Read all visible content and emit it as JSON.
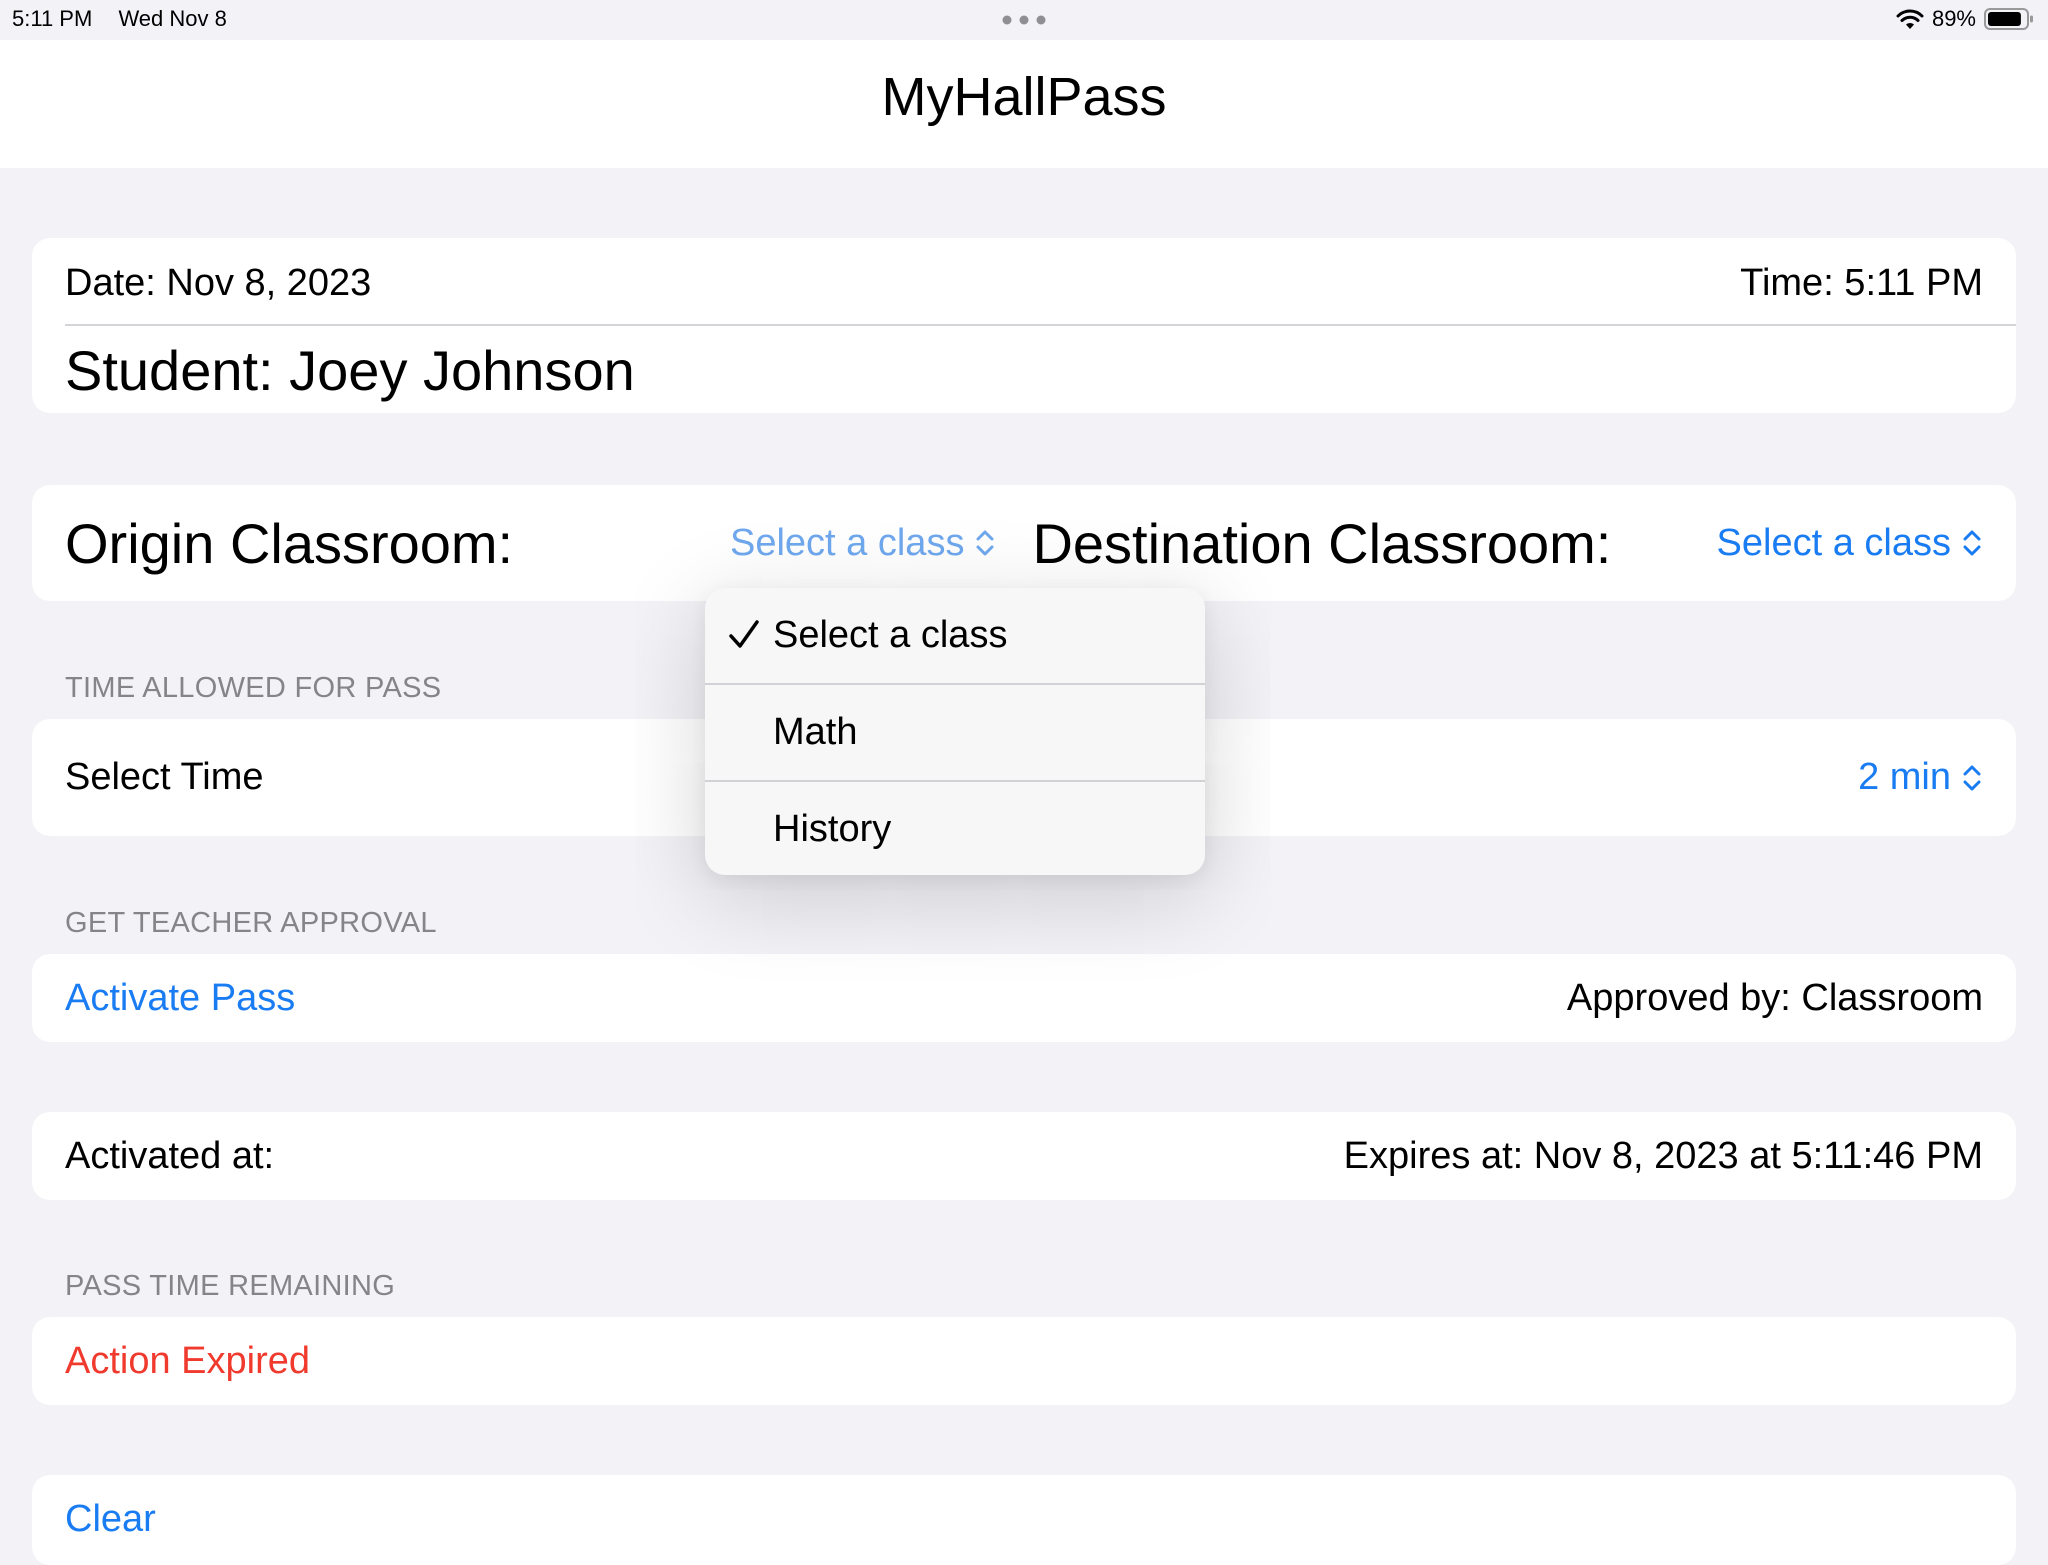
{
  "status": {
    "time": "5:11 PM",
    "date": "Wed Nov 8",
    "battery_percent": "89%",
    "battery_level": 0.89
  },
  "app": {
    "title": "MyHallPass"
  },
  "info_card": {
    "date": "Date: Nov 8, 2023",
    "time": "Time: 5:11 PM",
    "student": "Student: Joey Johnson"
  },
  "classroom_card": {
    "origin_label": "Origin Classroom:",
    "origin_value": "Select a class",
    "destination_label": "Destination Classroom:",
    "destination_value": "Select a class"
  },
  "time_section": {
    "header": "TIME ALLOWED FOR PASS",
    "label": "Select Time",
    "value": "2 min"
  },
  "approval_section": {
    "header": "GET TEACHER APPROVAL",
    "activate_label": "Activate Pass",
    "approved_by": "Approved by: Classroom"
  },
  "activation": {
    "activated_at": "Activated at:",
    "expires_at": "Expires at: Nov 8, 2023 at 5:11:46 PM"
  },
  "remaining_section": {
    "header": "PASS TIME REMAINING",
    "status": "Action Expired"
  },
  "clear_label": "Clear",
  "dropdown": {
    "selected": "Select a class",
    "options": [
      "Select a class",
      "Math",
      "History"
    ]
  },
  "colors": {
    "accent": "#1a7cf2",
    "error": "#f03a2e",
    "background": "#f2f2f7"
  }
}
